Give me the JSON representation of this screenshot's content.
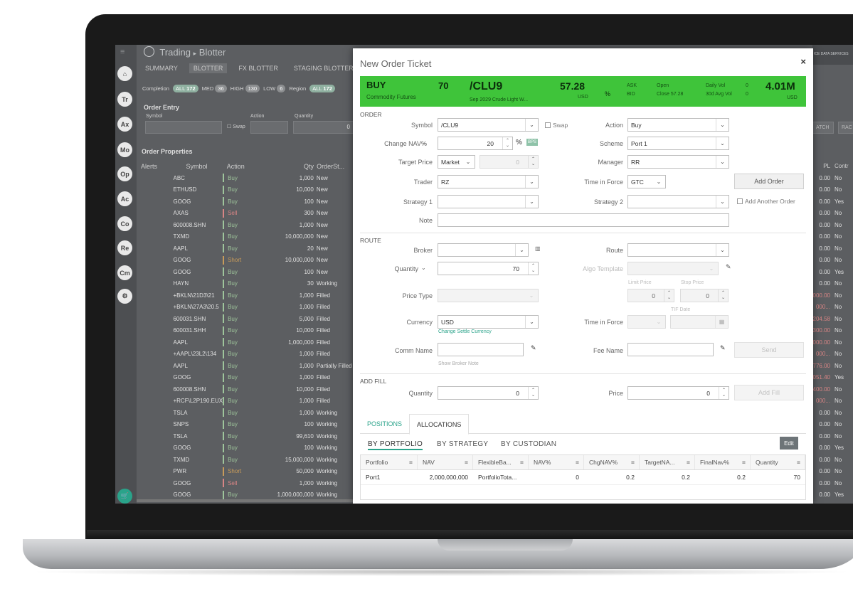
{
  "app": {
    "title": "Trading",
    "breadcrumb_sep": "▸",
    "breadcrumb": "Blotter",
    "tabs": [
      "SUMMARY",
      "BLOTTER",
      "FX BLOTTER",
      "STAGING BLOTTER"
    ],
    "filters": {
      "completion": "Completion",
      "all": "ALL",
      "all_count": "172",
      "med": "MED",
      "med_count": "36",
      "high": "HIGH",
      "high_count": "130",
      "low": "LOW",
      "low_count": "6",
      "region": "Region",
      "region_all": "ALL",
      "region_count": "172"
    },
    "order_entry": {
      "title": "Order Entry",
      "symbol": "Symbol",
      "action": "Action",
      "quantity": "Quantity",
      "swap": "Swap",
      "qty_value": "0"
    },
    "order_properties": "Order Properties",
    "nav": [
      "Tr",
      "Ax",
      "Mo",
      "Op",
      "Ac",
      "Co",
      "Re",
      "Cm"
    ],
    "columns": [
      "Alerts",
      "Symbol",
      "Action",
      "Qty",
      "OrderSt..."
    ],
    "right_columns": [
      "PL",
      "Contr"
    ],
    "right_buttons": [
      "ATCH",
      "RAC"
    ],
    "logo_text": "ICE DATA SERVICES",
    "rows": [
      {
        "symbol": "ABC",
        "action": "Buy",
        "qty": "1,000",
        "status": "New",
        "pl": "0.00",
        "c": "No"
      },
      {
        "symbol": "ETHUSD",
        "action": "Buy",
        "qty": "10,000",
        "status": "New",
        "pl": "0.00",
        "c": "No"
      },
      {
        "symbol": "GOOG",
        "action": "Buy",
        "qty": "100",
        "status": "New",
        "pl": "0.00",
        "c": "Yes"
      },
      {
        "symbol": "AXAS",
        "action": "Sell",
        "qty": "300",
        "status": "New",
        "pl": "0.00",
        "c": "No"
      },
      {
        "symbol": "600008.SHN",
        "action": "Buy",
        "qty": "1,000",
        "status": "New",
        "pl": "0.00",
        "c": "No"
      },
      {
        "symbol": "TXMD",
        "action": "Buy",
        "qty": "10,000,000",
        "status": "New",
        "pl": "0.00",
        "c": "No"
      },
      {
        "symbol": "AAPL",
        "action": "Buy",
        "qty": "20",
        "status": "New",
        "pl": "0.00",
        "c": "No"
      },
      {
        "symbol": "GOOG",
        "action": "Short",
        "qty": "10,000,000",
        "status": "New",
        "pl": "0.00",
        "c": "No"
      },
      {
        "symbol": "GOOG",
        "action": "Buy",
        "qty": "100",
        "status": "New",
        "pl": "0.00",
        "c": "Yes"
      },
      {
        "symbol": "HAYN",
        "action": "Buy",
        "qty": "30",
        "status": "Working",
        "pl": "0.00",
        "c": "No"
      },
      {
        "symbol": "+BKLN\\21D3\\21",
        "action": "Buy",
        "qty": "1,000",
        "status": "Filled",
        "pl": "000.00",
        "c": "No"
      },
      {
        "symbol": "+BKLN\\27A3\\20.5",
        "action": "Buy",
        "qty": "1,000",
        "status": "Filled",
        "pl": "000...",
        "c": "No"
      },
      {
        "symbol": "600031.SHN",
        "action": "Buy",
        "qty": "5,000",
        "status": "Filled",
        "pl": "204.58",
        "c": "No"
      },
      {
        "symbol": "600031.SHH",
        "action": "Buy",
        "qty": "10,000",
        "status": "Filled",
        "pl": "300.00",
        "c": "No"
      },
      {
        "symbol": "AAPL",
        "action": "Buy",
        "qty": "1,000,000",
        "status": "Filled",
        "pl": "000.00",
        "c": "No"
      },
      {
        "symbol": "+AAPL\\23L2\\134",
        "action": "Buy",
        "qty": "1,000",
        "status": "Filled",
        "pl": "000...",
        "c": "No"
      },
      {
        "symbol": "AAPL",
        "action": "Buy",
        "qty": "1,000",
        "status": "Partially Filled",
        "pl": "776.00",
        "c": "No"
      },
      {
        "symbol": "GOOG",
        "action": "Buy",
        "qty": "1,000",
        "status": "Filled",
        "pl": "051.40",
        "c": "Yes"
      },
      {
        "symbol": "600008.SHN",
        "action": "Buy",
        "qty": "10,000",
        "status": "Filled",
        "pl": "400.00",
        "c": "No"
      },
      {
        "symbol": "+RCF\\L2P190.EUX",
        "action": "Buy",
        "qty": "1,000",
        "status": "Filled",
        "pl": "000...",
        "c": "No"
      },
      {
        "symbol": "TSLA",
        "action": "Buy",
        "qty": "1,000",
        "status": "Working",
        "pl": "0.00",
        "c": "No"
      },
      {
        "symbol": "SNPS",
        "action": "Buy",
        "qty": "100",
        "status": "Working",
        "pl": "0.00",
        "c": "No"
      },
      {
        "symbol": "TSLA",
        "action": "Buy",
        "qty": "99,610",
        "status": "Working",
        "pl": "0.00",
        "c": "No"
      },
      {
        "symbol": "GOOG",
        "action": "Buy",
        "qty": "100",
        "status": "Working",
        "pl": "0.00",
        "c": "Yes"
      },
      {
        "symbol": "TXMD",
        "action": "Buy",
        "qty": "15,000,000",
        "status": "Working",
        "pl": "0.00",
        "c": "No"
      },
      {
        "symbol": "PWR",
        "action": "Short",
        "qty": "50,000",
        "status": "Working",
        "pl": "0.00",
        "c": "No"
      },
      {
        "symbol": "GOOG",
        "action": "Sell",
        "qty": "1,000",
        "status": "Working",
        "pl": "0.00",
        "c": "No"
      },
      {
        "symbol": "GOOG",
        "action": "Buy",
        "qty": "1,000,000,000",
        "status": "Working",
        "pl": "0.00",
        "c": "Yes"
      }
    ]
  },
  "modal": {
    "title": "New Order Ticket",
    "close": "×",
    "banner": {
      "side": "BUY",
      "asset_class": "Commodity Futures",
      "qty": "70",
      "symbol": "/CLU9",
      "desc": "Sep 2029 Crude Light W...",
      "price": "57.28",
      "currency": "USD",
      "pct": "%",
      "ask": "ASK",
      "bid": "BID",
      "open": "Open",
      "close": "Close 57.28",
      "daily_vol": "Daily Vol",
      "daily_vol_val": "0",
      "avg_vol": "30d Avg Vol",
      "avg_vol_val": "0",
      "value": "4.01M",
      "value_ccy": "USD"
    },
    "order": {
      "section": "ORDER",
      "symbol_label": "Symbol",
      "symbol_value": "/CLU9",
      "swap_label": "Swap",
      "action_label": "Action",
      "action_value": "Buy",
      "change_nav_label": "Change NAV%",
      "change_nav_value": "20",
      "pct": "%",
      "bps": "BPS",
      "scheme_label": "Scheme",
      "scheme_value": "Port 1",
      "target_price_label": "Target Price",
      "target_price_type": "Market",
      "target_price_value": "0",
      "manager_label": "Manager",
      "manager_value": "RR",
      "trader_label": "Trader",
      "trader_value": "RZ",
      "tif_label": "Time in Force",
      "tif_value": "GTC",
      "add_order": "Add Order",
      "strategy1_label": "Strategy 1",
      "strategy2_label": "Strategy 2",
      "add_another": "Add Another Order",
      "note_label": "Note"
    },
    "route": {
      "section": "ROUTE",
      "broker_label": "Broker",
      "route_label": "Route",
      "quantity_label": "Quantity",
      "quantity_value": "70",
      "algo_label": "Algo Template",
      "limit_label": "Limit Price",
      "limit_value": "0",
      "stop_label": "Stop Price",
      "stop_value": "0",
      "price_type_label": "Price Type",
      "tif_date_label": "TIF Date",
      "currency_label": "Currency",
      "currency_value": "USD",
      "change_settle": "Change Settle Currency",
      "tif_label": "Time in Force",
      "comm_label": "Comm Name",
      "fee_label": "Fee Name",
      "send": "Send",
      "broker_note": "Show Broker Note"
    },
    "fill": {
      "section": "ADD FILL",
      "quantity_label": "Quantity",
      "quantity_value": "0",
      "price_label": "Price",
      "price_value": "0",
      "add_fill": "Add Fill"
    },
    "tabs": [
      "POSITIONS",
      "ALLOCATIONS"
    ],
    "subtabs": [
      "BY PORTFOLIO",
      "BY STRATEGY",
      "BY CUSTODIAN"
    ],
    "edit": "Edit",
    "table": {
      "headers": [
        "Portfolio",
        "NAV",
        "FlexibleBa...",
        "NAV%",
        "ChgNAV%",
        "TargetNA...",
        "FinalNav%",
        "Quantity"
      ],
      "rows": [
        [
          "Port1",
          "2,000,000,000",
          "PortfolioTota...",
          "0",
          "0.2",
          "0.2",
          "0.2",
          "70"
        ]
      ]
    }
  },
  "colors": {
    "banner": "#3fc43a",
    "accent": "#2aa38a",
    "buy": "#9ec59b",
    "sell": "#d88585"
  }
}
